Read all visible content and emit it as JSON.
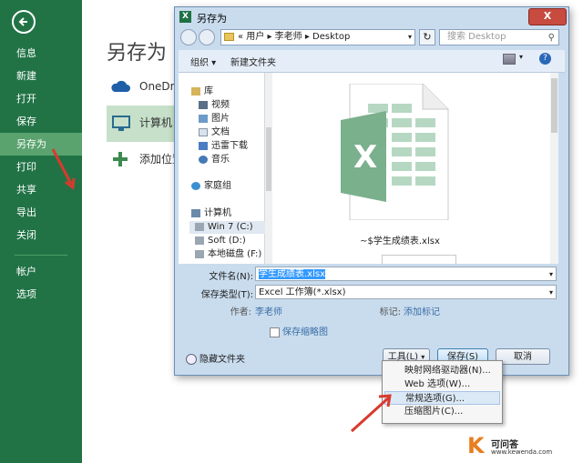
{
  "sidebar": {
    "items": [
      {
        "label": "信息"
      },
      {
        "label": "新建"
      },
      {
        "label": "打开"
      },
      {
        "label": "保存"
      },
      {
        "label": "另存为"
      },
      {
        "label": "打印"
      },
      {
        "label": "共享"
      },
      {
        "label": "导出"
      },
      {
        "label": "关闭"
      },
      {
        "label": "帐户"
      },
      {
        "label": "选项"
      }
    ],
    "active_index": 4,
    "accent_color": "#217346"
  },
  "backstage": {
    "title": "另存为",
    "locations": [
      {
        "label": "OneDrive",
        "icon": "cloud-icon"
      },
      {
        "label": "计算机",
        "icon": "computer-icon"
      },
      {
        "label": "添加位置",
        "icon": "plus-icon"
      }
    ]
  },
  "dialog": {
    "title": "另存为",
    "close_label": "X",
    "address_path": "« 用户 ▸ 李老师 ▸ Desktop",
    "search_placeholder": "搜索 Desktop",
    "toolbar": {
      "organize_label": "组织 ▾",
      "new_folder_label": "新建文件夹"
    },
    "nav_items": [
      {
        "label": "库",
        "icon": "library-icon"
      },
      {
        "label": "视频",
        "icon": "video-icon"
      },
      {
        "label": "图片",
        "icon": "picture-icon"
      },
      {
        "label": "文档",
        "icon": "document-icon"
      },
      {
        "label": "迅雷下载",
        "icon": "download-icon"
      },
      {
        "label": "音乐",
        "icon": "music-icon"
      },
      {
        "label": "家庭组",
        "icon": "homegroup-icon"
      },
      {
        "label": "计算机",
        "icon": "computer-icon"
      },
      {
        "label": "Win 7 (C:)",
        "icon": "drive-icon"
      },
      {
        "label": "Soft (D:)",
        "icon": "drive-icon"
      },
      {
        "label": "本地磁盘 (F:)",
        "icon": "drive-icon"
      }
    ],
    "file": {
      "name": "~$学生成绩表.xlsx",
      "icon": "excel-file-icon"
    },
    "form": {
      "filename_label": "文件名(N):",
      "filename_value": "学生成绩表.xlsx",
      "filetype_label": "保存类型(T):",
      "filetype_value": "Excel 工作簿(*.xlsx)",
      "author_label": "作者:",
      "author_value": "李老师",
      "tags_label": "标记:",
      "tags_value": "添加标记",
      "thumbnail_label": "保存缩略图"
    },
    "hide_folders_label": "隐藏文件夹",
    "buttons": {
      "tools_label": "工具(L)",
      "save_label": "保存(S)",
      "cancel_label": "取消"
    },
    "tools_menu": [
      {
        "label": "映射网络驱动器(N)..."
      },
      {
        "label": "Web 选项(W)..."
      },
      {
        "label": "常规选项(G)..."
      },
      {
        "label": "压缩图片(C)..."
      }
    ],
    "tools_menu_highlight_index": 2
  },
  "watermark": {
    "letter": "K",
    "title": "可问答",
    "url": "www.kewenda.com"
  }
}
